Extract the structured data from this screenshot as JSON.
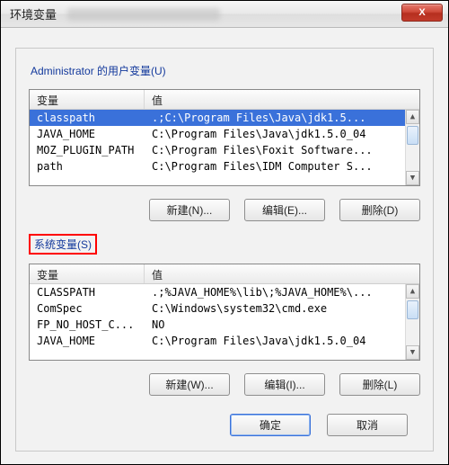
{
  "window": {
    "title": "环境变量",
    "close_label": "X"
  },
  "user_section": {
    "label": "Administrator 的用户变量(U)",
    "columns": {
      "var": "变量",
      "val": "值"
    },
    "rows": [
      {
        "var": "classpath",
        "val": ".;C:\\Program Files\\Java\\jdk1.5..."
      },
      {
        "var": "JAVA_HOME",
        "val": "C:\\Program Files\\Java\\jdk1.5.0_04"
      },
      {
        "var": "MOZ_PLUGIN_PATH",
        "val": "C:\\Program Files\\Foxit Software..."
      },
      {
        "var": "path",
        "val": "C:\\Program Files\\IDM Computer S..."
      }
    ],
    "buttons": {
      "new": "新建(N)...",
      "edit": "编辑(E)...",
      "delete": "删除(D)"
    }
  },
  "system_section": {
    "label": "系统变量(S)",
    "columns": {
      "var": "变量",
      "val": "值"
    },
    "rows": [
      {
        "var": "CLASSPATH",
        "val": ".;%JAVA_HOME%\\lib\\;%JAVA_HOME%\\..."
      },
      {
        "var": "ComSpec",
        "val": "C:\\Windows\\system32\\cmd.exe"
      },
      {
        "var": "FP_NO_HOST_C...",
        "val": "NO"
      },
      {
        "var": "JAVA_HOME",
        "val": "C:\\Program Files\\Java\\jdk1.5.0_04"
      }
    ],
    "buttons": {
      "new": "新建(W)...",
      "edit": "编辑(I)...",
      "delete": "删除(L)"
    }
  },
  "footer": {
    "ok": "确定",
    "cancel": "取消"
  }
}
